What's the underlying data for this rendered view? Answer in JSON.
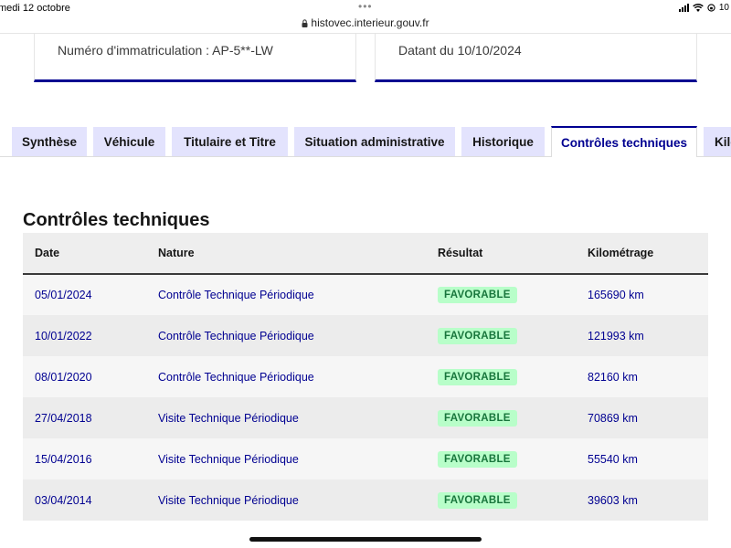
{
  "statusbar": {
    "date": "medi 12 octobre",
    "dots": "•••",
    "battery_text": "10"
  },
  "browser": {
    "url": "histovec.interieur.gouv.fr"
  },
  "cards": {
    "registration": "Numéro d'immatriculation : AP-5**-LW",
    "dated": "Datant du 10/10/2024"
  },
  "tabs": [
    {
      "label": "Synthèse",
      "active": false
    },
    {
      "label": "Véhicule",
      "active": false
    },
    {
      "label": "Titulaire et Titre",
      "active": false
    },
    {
      "label": "Situation administrative",
      "active": false
    },
    {
      "label": "Historique",
      "active": false
    },
    {
      "label": "Contrôles techniques",
      "active": true
    },
    {
      "label": "Kilo",
      "active": false
    }
  ],
  "section": {
    "title": "Contrôles techniques"
  },
  "table": {
    "headers": {
      "date": "Date",
      "nature": "Nature",
      "result": "Résultat",
      "mileage": "Kilométrage"
    },
    "rows": [
      {
        "date": "05/01/2024",
        "nature": "Contrôle Technique Périodique",
        "result": "FAVORABLE",
        "mileage": "165690 km"
      },
      {
        "date": "10/01/2022",
        "nature": "Contrôle Technique Périodique",
        "result": "FAVORABLE",
        "mileage": "121993 km"
      },
      {
        "date": "08/01/2020",
        "nature": "Contrôle Technique Périodique",
        "result": "FAVORABLE",
        "mileage": "82160 km"
      },
      {
        "date": "27/04/2018",
        "nature": "Visite Technique Périodique",
        "result": "FAVORABLE",
        "mileage": "70869 km"
      },
      {
        "date": "15/04/2016",
        "nature": "Visite Technique Périodique",
        "result": "FAVORABLE",
        "mileage": "55540 km"
      },
      {
        "date": "03/04/2014",
        "nature": "Visite Technique Périodique",
        "result": "FAVORABLE",
        "mileage": "39603 km"
      }
    ]
  },
  "colors": {
    "accent": "#000091",
    "tab_bg": "#e3e3fd",
    "badge_bg": "#b8fec9",
    "badge_text": "#18753c"
  }
}
